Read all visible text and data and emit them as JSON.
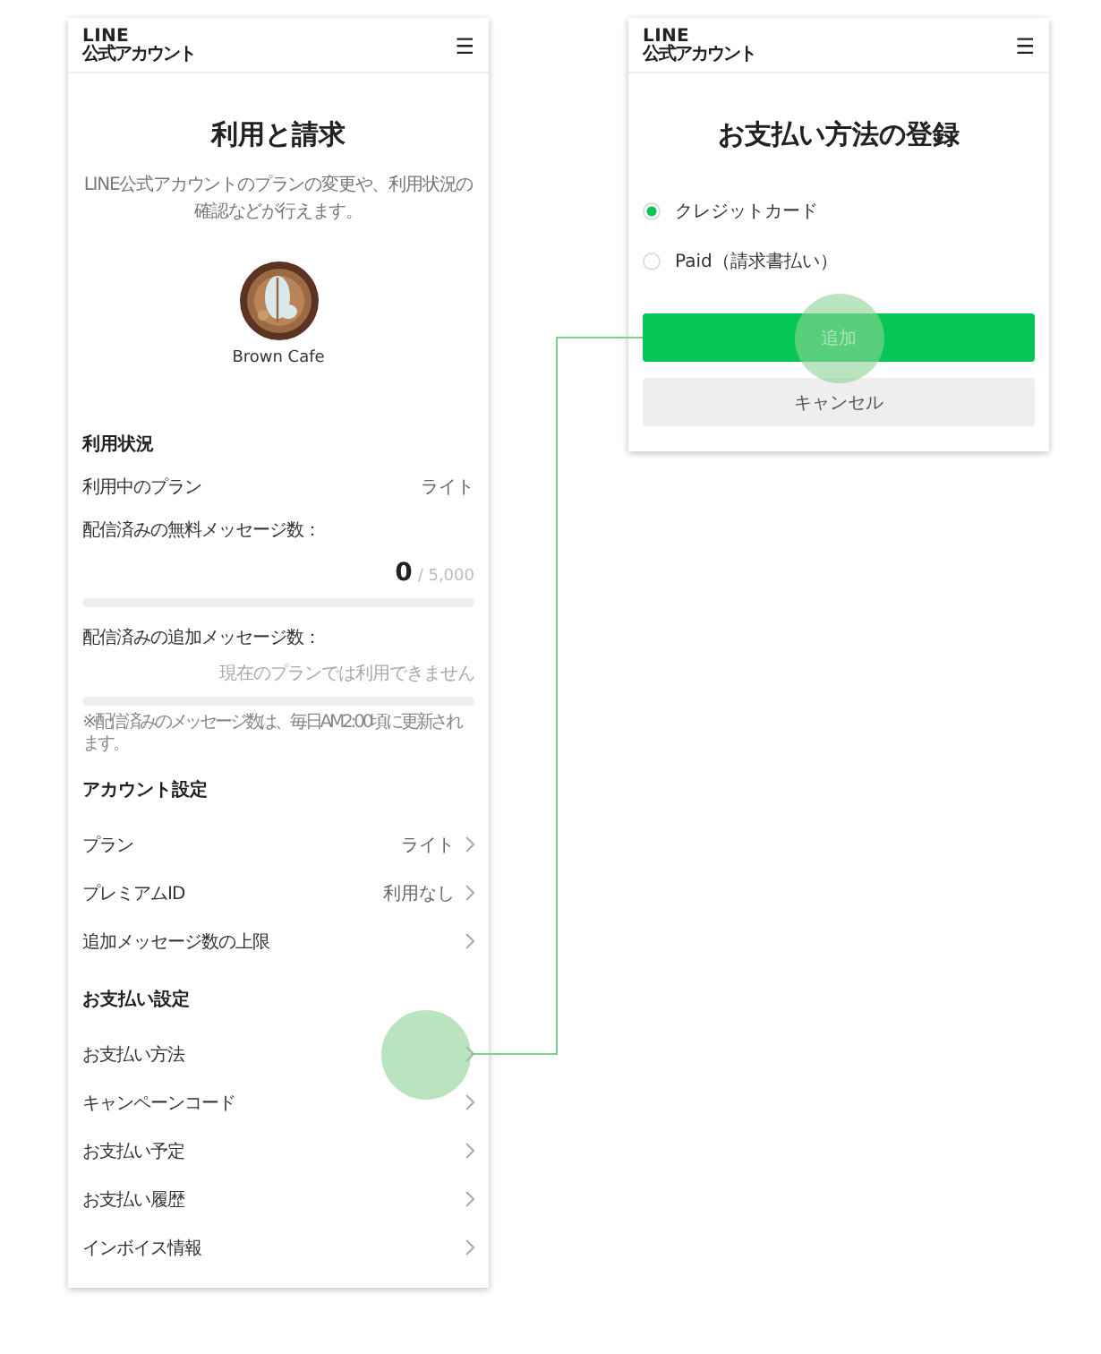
{
  "left_screen": {
    "header": {
      "logo_top": "LINE",
      "logo_bottom": "公式アカウント",
      "menu": "☰"
    },
    "title": "利用と請求",
    "description": "LINE公式アカウントのプランの変更や、利用状況の確認などが行えます。",
    "account": {
      "name": "Brown Cafe"
    },
    "usage": {
      "heading": "利用状況",
      "plan_label": "利用中のプラン",
      "plan_value": "ライト",
      "free_messages": {
        "label": "配信済みの無料メッセージ数：",
        "count": "0",
        "limit": "/ 5,000",
        "level": 0
      },
      "additional_messages": {
        "label": "配信済みの追加メッセージ数：",
        "note": "現在のプランでは利用できません",
        "level": 0
      },
      "footnote": "※配信済みのメッセージ数は、毎日AM2:00頃に更新されます。"
    },
    "sections": [
      {
        "heading": "アカウント設定",
        "items": [
          {
            "label": "プラン",
            "value": "ライト",
            "highlighted": false
          },
          {
            "label": "プレミアムID",
            "value": "利用なし",
            "highlighted": false
          },
          {
            "label": "追加メッセージ数の上限",
            "highlighted": false
          }
        ]
      },
      {
        "heading": "お支払い設定",
        "items": [
          {
            "label": "お支払い方法",
            "highlighted": true
          },
          {
            "label": "キャンペーンコード",
            "highlighted": false
          },
          {
            "label": "お支払い予定",
            "highlighted": false
          },
          {
            "label": "お支払い履歴",
            "highlighted": false
          },
          {
            "label": "インボイス情報",
            "highlighted": false
          }
        ]
      }
    ]
  },
  "right_screen": {
    "header": {
      "logo_top": "LINE",
      "logo_bottom": "公式アカウント",
      "menu": "☰"
    },
    "title": "お支払い方法の登録",
    "options": [
      {
        "label": "クレジットカード",
        "selected": true
      },
      {
        "label": "Paid（請求書払い）",
        "selected": false
      }
    ],
    "buttons": [
      {
        "label": "追加",
        "kind": "primary",
        "highlighted": true
      },
      {
        "label": "キャンセル",
        "kind": "secondary",
        "highlighted": false
      }
    ]
  }
}
